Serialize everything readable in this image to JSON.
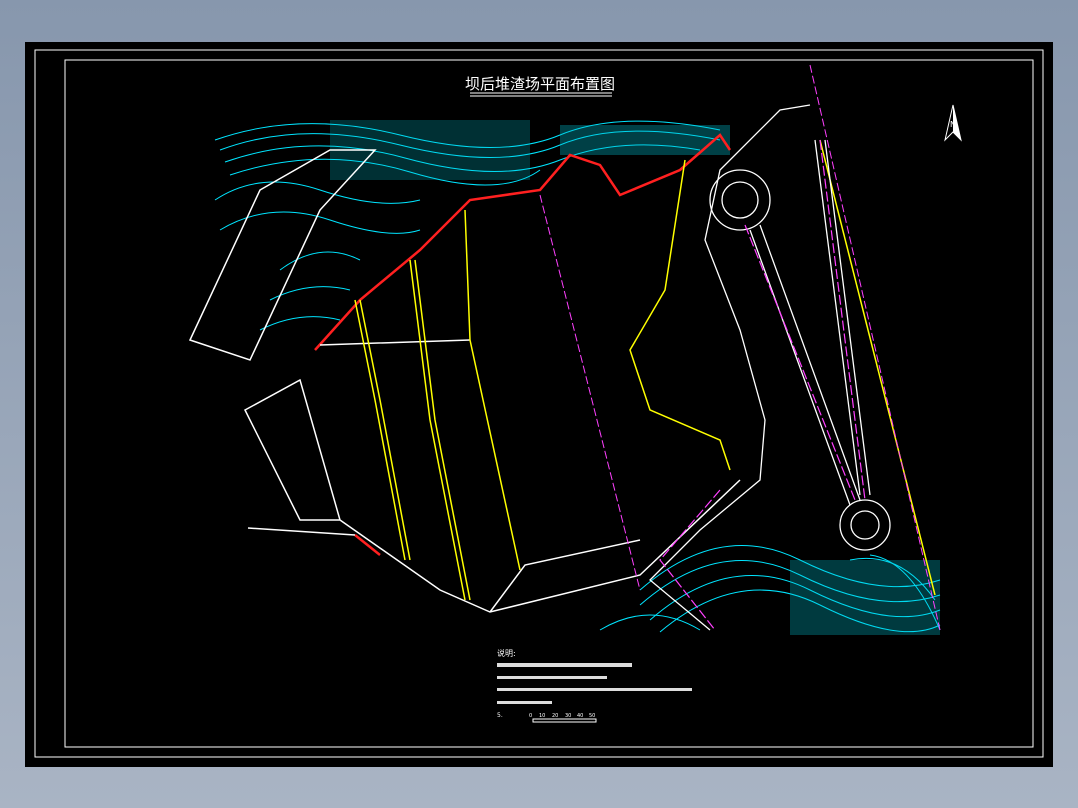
{
  "drawing": {
    "title": "坝后堆渣场平面布置图",
    "notes_heading": "说明:",
    "scale_ticks": [
      "0",
      "10",
      "20",
      "30",
      "40",
      "50"
    ],
    "north_label": "N"
  },
  "colors": {
    "background": "#000000",
    "contour": "#00e5ff",
    "boundary_red": "#ff2020",
    "road_magenta": "#ff40ff",
    "line_yellow": "#ffff00",
    "frame": "#ffffff"
  }
}
